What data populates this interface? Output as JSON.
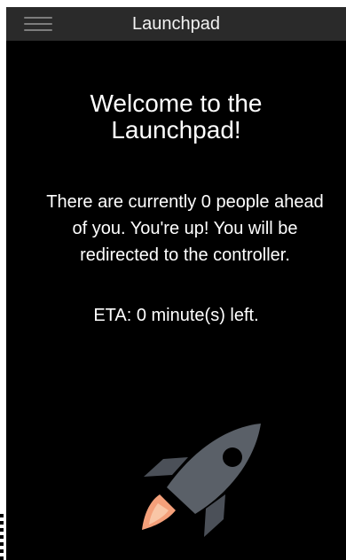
{
  "topbar": {
    "title": "Launchpad",
    "menu_icon": "hamburger-menu-icon",
    "background": "#2a2a2a"
  },
  "main": {
    "welcome": "Welcome to the Launchpad!",
    "queue_message": "There are currently 0 people ahead of you. You're up! You will be redirected to the controller.",
    "eta": "ETA: 0 minute(s) left.",
    "illustration_icon": "rocket-icon"
  },
  "colors": {
    "background": "#000000",
    "text": "#ffffff",
    "rocket_body": "#5a6068",
    "rocket_flame": "#f4a07a"
  }
}
